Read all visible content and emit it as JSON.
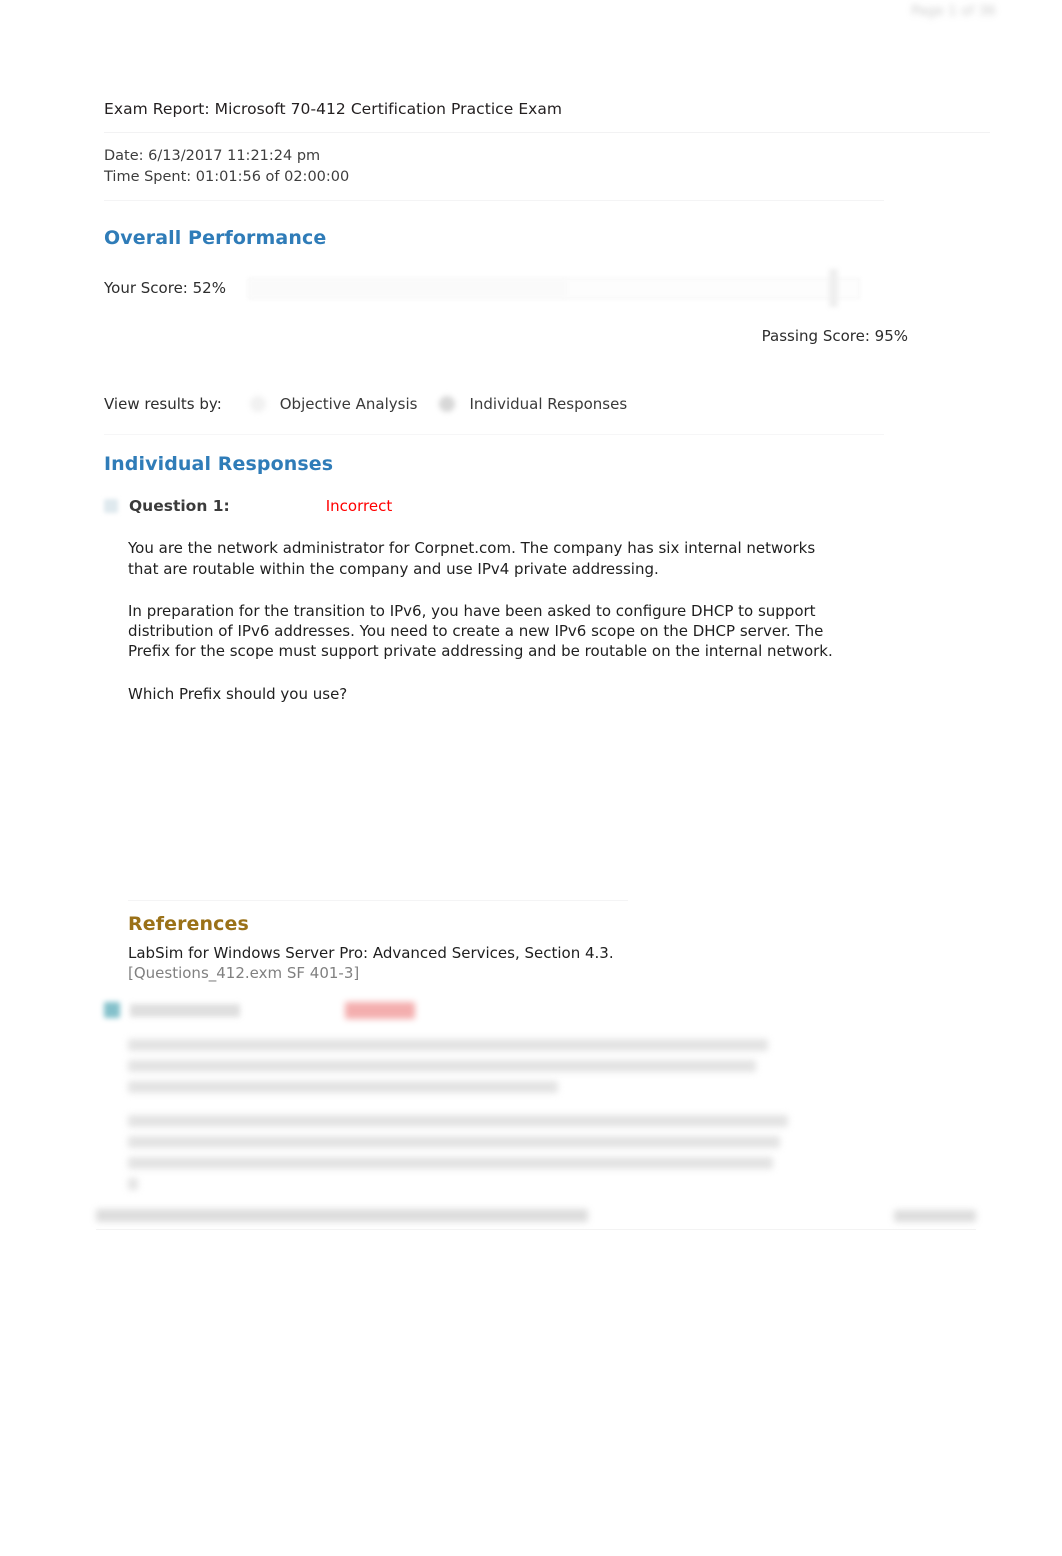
{
  "document": {
    "page_number": "Page 1 of 36",
    "report_title": "Exam Report: Microsoft 70-412 Certification Practice Exam",
    "date_line": "Date: 6/13/2017 11:21:24 pm",
    "time_line": "Time Spent: 01:01:56 of 02:00:00"
  },
  "overall_performance": {
    "heading": "Overall Performance",
    "score_label": "Your Score: 52%",
    "score_value": 52,
    "passing_label": "Passing Score: 95%",
    "passing_value": 95
  },
  "view_results": {
    "label": "View results by:",
    "options": [
      {
        "label": "Objective Analysis",
        "selected": false
      },
      {
        "label": "Individual Responses",
        "selected": true
      }
    ]
  },
  "individual_responses": {
    "heading": "Individual Responses",
    "question": {
      "label": "Question 1:",
      "status": "Incorrect",
      "status_color": "#ff0000",
      "paragraphs": [
        "You are the network administrator for Corpnet.com. The company has six internal networks that are routable within the company and use IPv4 private addressing.",
        "In preparation for the transition to IPv6, you have been asked to configure DHCP to support distribution of IPv6 addresses. You need to create a new IPv6 scope on the DHCP server. The Prefix for the scope must support private addressing and be routable on the internal network.",
        "Which Prefix should you use?"
      ]
    },
    "references": {
      "heading": "References",
      "citation": "LabSim for Windows Server Pro: Advanced Services, Section 4.3.",
      "code": "[Questions_412.exm SF 401-3]"
    }
  },
  "colors": {
    "section_heading_blue": "#2f7cb8",
    "references_gold": "#9a7118",
    "incorrect_red": "#ff0000",
    "page_background": "#ffffff"
  }
}
